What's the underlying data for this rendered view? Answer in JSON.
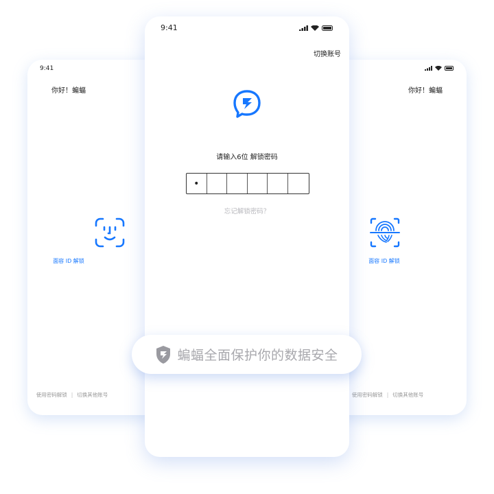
{
  "left_phone": {
    "time": "9:41",
    "greeting": "你好！蝙蝠",
    "bio_label": "面容 ID 解锁",
    "footer": {
      "password_unlock": "使用密码解锁",
      "separator": "|",
      "switch_account": "切换其他账号"
    }
  },
  "right_phone": {
    "greeting": "你好！蝙蝠",
    "bio_label": "面容 ID 解锁",
    "footer": {
      "password_unlock": "使用密码解锁",
      "separator": "|",
      "switch_account": "切换其他账号"
    }
  },
  "center_phone": {
    "time": "9:41",
    "switch_account": "切换账号",
    "prompt": "请输入6位 解锁密码",
    "pin": [
      "•",
      "",
      "",
      "",
      "",
      ""
    ],
    "forgot": "忘记解锁密码？"
  },
  "banner": {
    "text": "蝙蝠全面保护你的数据安全"
  },
  "colors": {
    "accent": "#1677ff"
  }
}
